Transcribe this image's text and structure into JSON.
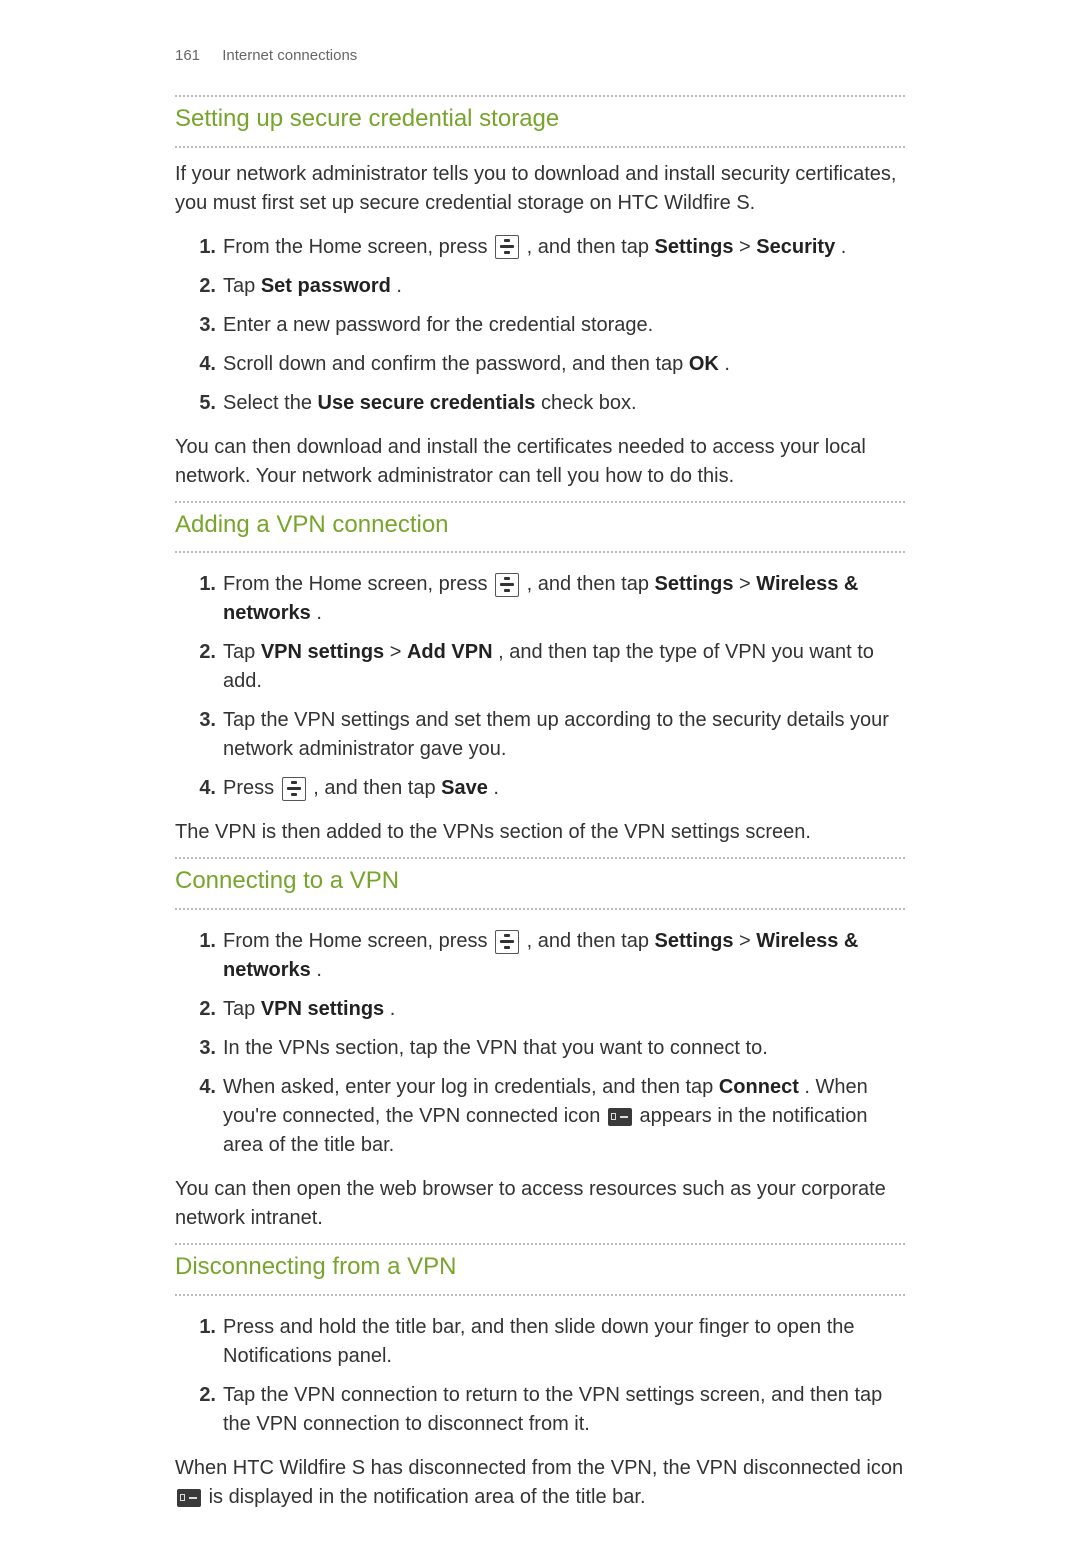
{
  "header": {
    "page_number": "161",
    "section": "Internet connections"
  },
  "s1": {
    "title": "Setting up secure credential storage",
    "intro": "If your network administrator tells you to download and install security certificates, you must first set up secure credential storage on HTC Wildfire S.",
    "step1_a": "From the Home screen, press ",
    "step1_b": " , and then tap ",
    "step1_settings": "Settings",
    "step1_gt": " > ",
    "step1_security": "Security",
    "step1_end": ".",
    "step2_a": "Tap ",
    "step2_b": "Set password",
    "step2_c": ".",
    "step3": "Enter a new password for the credential storage.",
    "step4_a": "Scroll down and confirm the password, and then tap ",
    "step4_ok": "OK",
    "step4_b": ".",
    "step5_a": "Select the ",
    "step5_b": "Use secure credentials",
    "step5_c": " check box.",
    "outro": "You can then download and install the certificates needed to access your local network. Your network administrator can tell you how to do this."
  },
  "s2": {
    "title": "Adding a VPN connection",
    "step1_a": "From the Home screen, press ",
    "step1_b": " , and then tap ",
    "step1_settings": "Settings",
    "step1_gt": " > ",
    "step1_wn": "Wireless & networks",
    "step1_end": ".",
    "step2_a": "Tap ",
    "step2_vpn": "VPN settings",
    "step2_gt": " > ",
    "step2_add": "Add VPN",
    "step2_b": ", and then tap the type of VPN you want to add.",
    "step3": "Tap the VPN settings and set them up according to the security details your network administrator gave you.",
    "step4_a": "Press ",
    "step4_b": " , and then tap ",
    "step4_save": "Save",
    "step4_c": ".",
    "outro": "The VPN is then added to the VPNs section of the VPN settings screen."
  },
  "s3": {
    "title": "Connecting to a VPN",
    "step1_a": "From the Home screen, press ",
    "step1_b": " , and then tap ",
    "step1_settings": "Settings",
    "step1_gt": " > ",
    "step1_wn": "Wireless & networks",
    "step1_end": ".",
    "step2_a": "Tap ",
    "step2_vpn": "VPN settings",
    "step2_b": ".",
    "step3": "In the VPNs section, tap the VPN that you want to connect to.",
    "step4_a": "When asked, enter your log in credentials, and then tap ",
    "step4_connect": "Connect",
    "step4_b": ". When you're connected, the VPN connected icon ",
    "step4_c": " appears in the notification area of the title bar.",
    "outro": "You can then open the web browser to access resources such as your corporate network intranet."
  },
  "s4": {
    "title": "Disconnecting from a VPN",
    "step1": "Press and hold the title bar, and then slide down your finger to open the Notifications panel.",
    "step2": "Tap the VPN connection to return to the VPN settings screen, and then tap the VPN connection to disconnect from it.",
    "outro_a": "When HTC Wildfire S has disconnected from the VPN, the VPN disconnected icon ",
    "outro_b": " is displayed in the notification area of the title bar."
  },
  "nums": {
    "n1": "1.",
    "n2": "2.",
    "n3": "3.",
    "n4": "4.",
    "n5": "5."
  }
}
